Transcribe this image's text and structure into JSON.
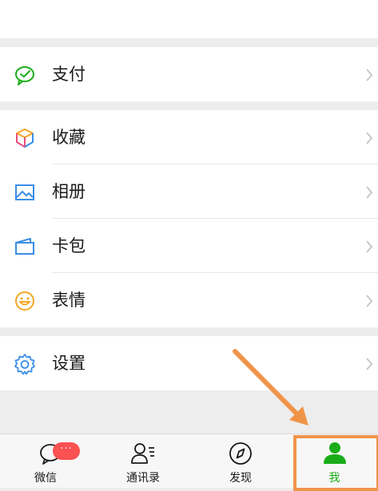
{
  "menu": {
    "pay": {
      "label": "支付",
      "icon": "wechat-pay-icon"
    },
    "favorites": {
      "label": "收藏",
      "icon": "cube-icon"
    },
    "album": {
      "label": "相册",
      "icon": "picture-icon"
    },
    "cards": {
      "label": "卡包",
      "icon": "wallet-icon"
    },
    "stickers": {
      "label": "表情",
      "icon": "smiley-icon"
    },
    "settings": {
      "label": "设置",
      "icon": "gear-icon"
    }
  },
  "tabbar": {
    "chats": {
      "label": "微信",
      "badge": "···",
      "icon": "chat-bubble-icon"
    },
    "contacts": {
      "label": "通讯录",
      "icon": "contacts-icon"
    },
    "discover": {
      "label": "发现",
      "icon": "compass-icon"
    },
    "me": {
      "label": "我",
      "icon": "person-icon",
      "active": true
    }
  },
  "colors": {
    "accent_green": "#1aad19",
    "badge_red": "#fa5151",
    "annotation_orange": "#f0944a"
  }
}
